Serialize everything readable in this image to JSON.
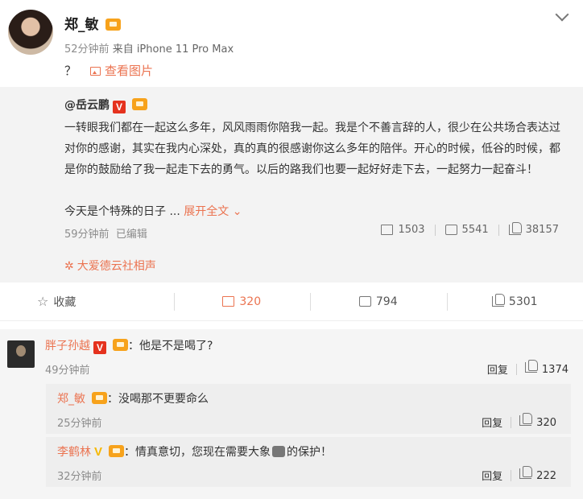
{
  "post": {
    "username": "郑_敏",
    "time": "52分钟前",
    "source": "来自 iPhone 11 Pro Max",
    "text": "？",
    "view_pic": "查看图片"
  },
  "repost": {
    "author": "@岳云鹏",
    "text": "一转眼我们都在一起这么多年，风风雨雨你陪我一起。我是个不善言辞的人，很少在公共场合表达过对你的感谢，其实在我内心深处，真的真的很感谢你这么多年的陪伴。开心的时候，低谷的时候，都是你的鼓励给了我一起走下去的勇气。以后的路我们也要一起好好走下去，一起努力一起奋斗！",
    "text_more": "今天是个特殊的日子 ...",
    "expand": "展开全文",
    "time": "59分钟前",
    "edited": "已编辑",
    "forward_count": "1503",
    "comment_count": "5541",
    "like_count": "38157",
    "topic": "大爱德云社相声"
  },
  "actions": {
    "favorite": "收藏",
    "forward": "320",
    "comment": "794",
    "like": "5301"
  },
  "comments": [
    {
      "name": "胖子孙越",
      "v": "V",
      "text": "：他是不是喝了?",
      "time": "49分钟前",
      "reply": "回复",
      "likes": "1374"
    }
  ],
  "replies": [
    {
      "name": "郑_敏",
      "text": "：没喝那不更要命么",
      "time": "25分钟前",
      "reply": "回复",
      "likes": "320"
    },
    {
      "name": "李鹤林",
      "v": "V",
      "text_a": "：情真意切，您现在需要大象",
      "text_b": "的保护！",
      "time": "32分钟前",
      "reply": "回复",
      "likes": "222"
    }
  ],
  "colors": {
    "accent": "#eb7350",
    "v_red": "#e5321e",
    "v_yellow": "#f6b800",
    "fan_badge": "#f7a21b"
  },
  "icons": [
    "chevron-down-icon",
    "image-icon",
    "forward-icon",
    "comment-icon",
    "like-icon",
    "star-icon",
    "topic-icon",
    "elephant-emoji-icon"
  ]
}
